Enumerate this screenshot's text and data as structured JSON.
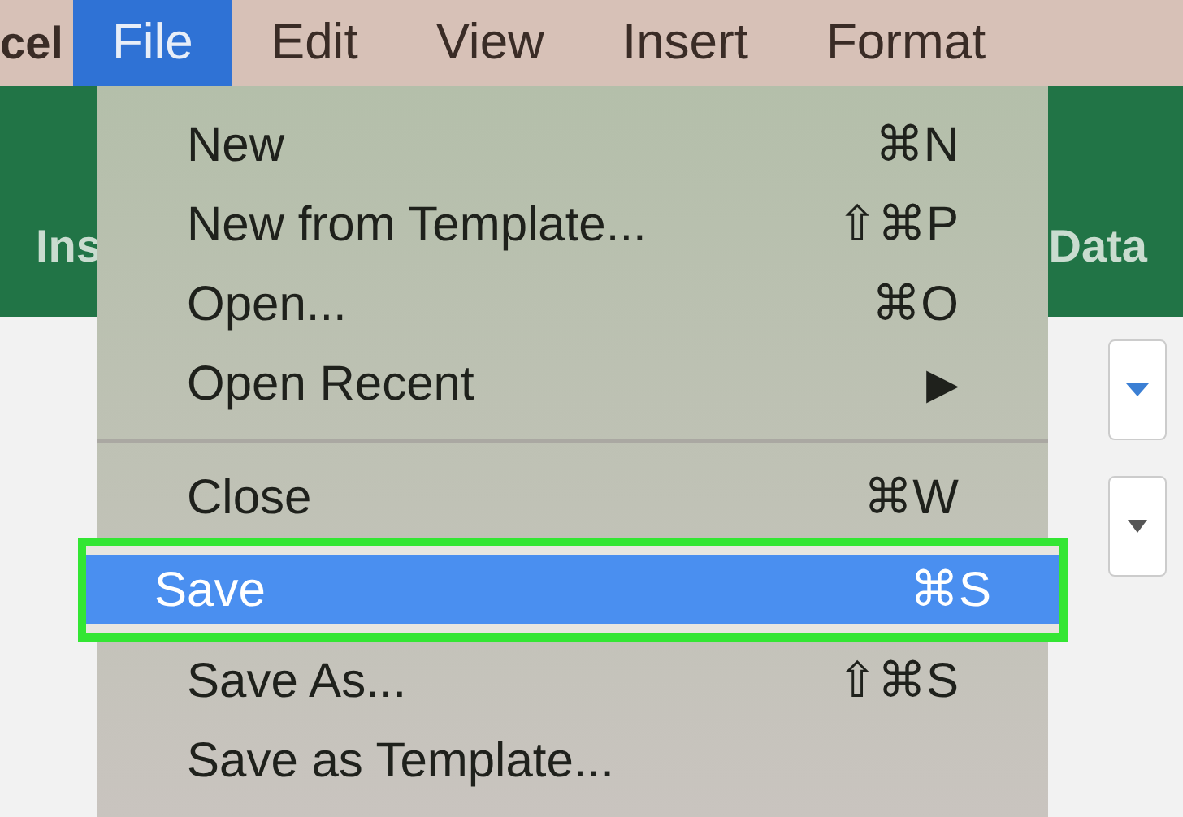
{
  "menu_bar": [
    {
      "label": "cel",
      "selected": false
    },
    {
      "label": "File",
      "selected": true
    },
    {
      "label": "Edit",
      "selected": false
    },
    {
      "label": "View",
      "selected": false
    },
    {
      "label": "Insert",
      "selected": false
    },
    {
      "label": "Format",
      "selected": false
    }
  ],
  "ribbon_tabs": [
    {
      "label": "Ins"
    },
    {
      "label": "Data"
    }
  ],
  "file_menu": {
    "groups": [
      [
        {
          "label": "New",
          "shortcut": "⌘N",
          "kind": "command",
          "selected": false,
          "outlined": false
        },
        {
          "label": "New from Template...",
          "shortcut": "⇧⌘P",
          "kind": "command",
          "selected": false,
          "outlined": false
        },
        {
          "label": "Open...",
          "shortcut": "⌘O",
          "kind": "command",
          "selected": false,
          "outlined": false
        },
        {
          "label": "Open Recent",
          "shortcut": "▶",
          "kind": "submenu",
          "selected": false,
          "outlined": false
        }
      ],
      [
        {
          "label": "Close",
          "shortcut": "⌘W",
          "kind": "command",
          "selected": false,
          "outlined": false
        },
        {
          "label": "Save",
          "shortcut": "⌘S",
          "kind": "command",
          "selected": true,
          "outlined": true
        },
        {
          "label": "Save As...",
          "shortcut": "⇧⌘S",
          "kind": "command",
          "selected": false,
          "outlined": false
        },
        {
          "label": "Save as Template...",
          "kind": "command",
          "selected": false,
          "outlined": false
        }
      ]
    ]
  }
}
